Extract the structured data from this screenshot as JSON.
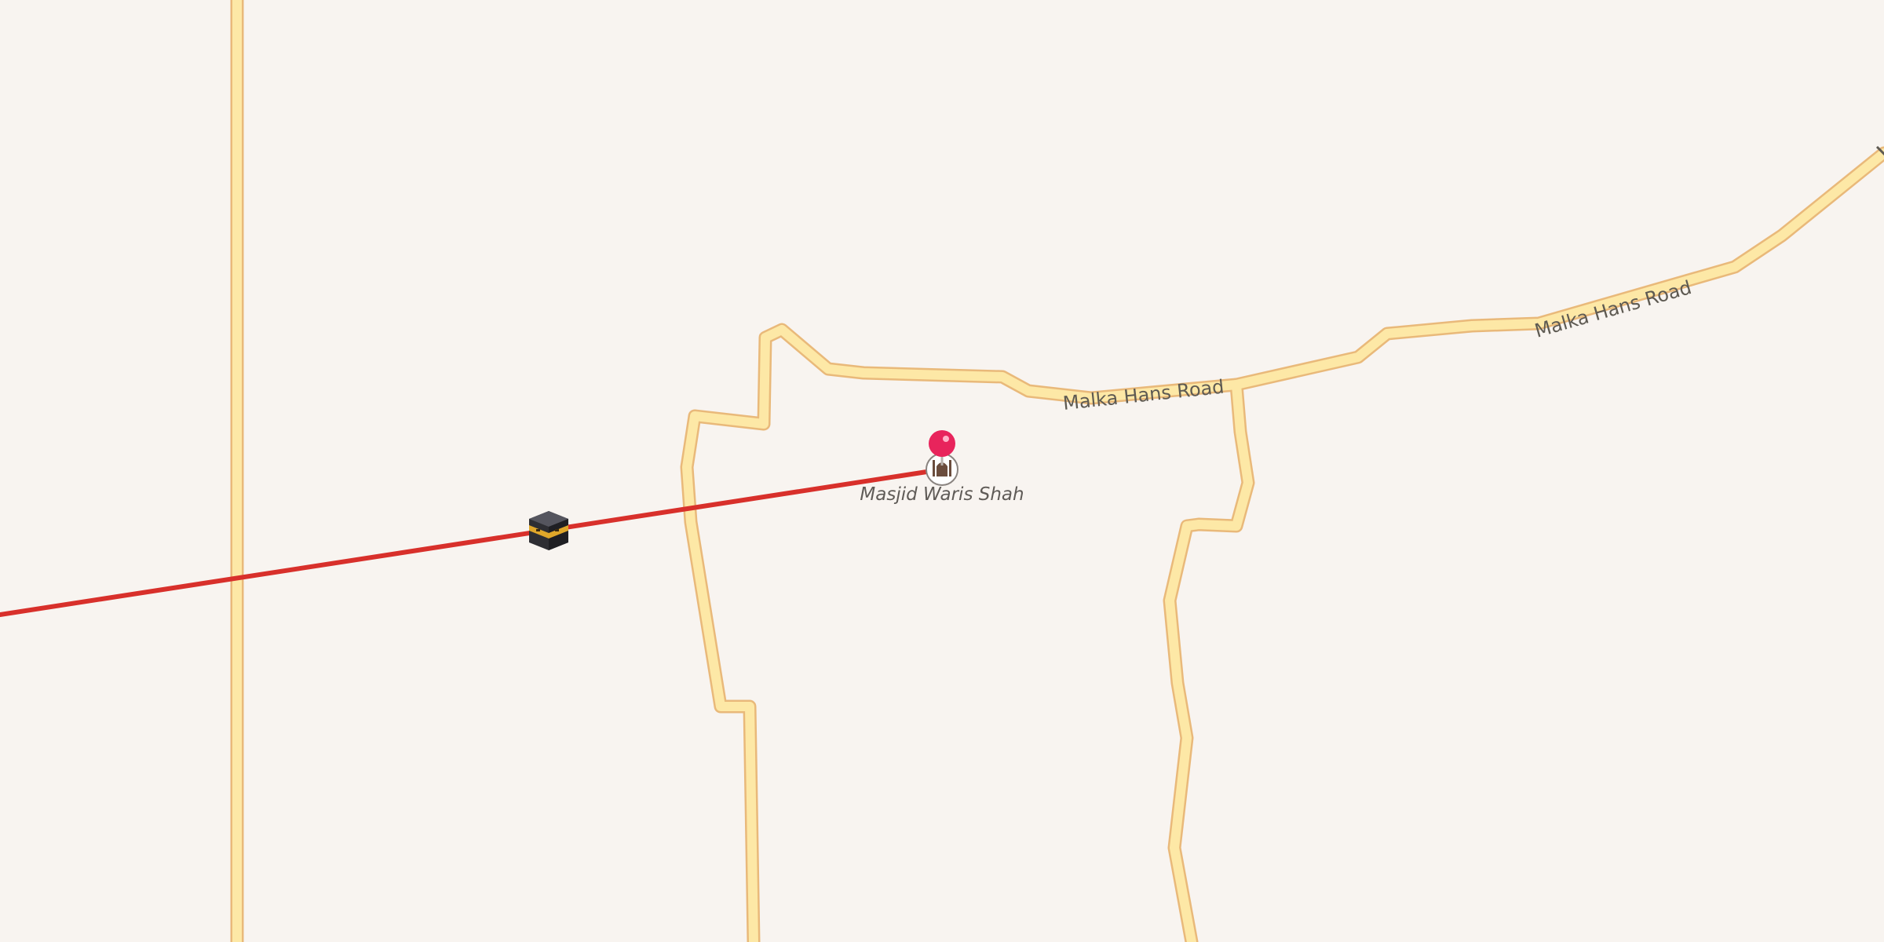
{
  "map": {
    "roads": [
      {
        "name": "Malka Hans Road",
        "labels": [
          "Malka Hans Road",
          "Malka Hans Road"
        ]
      }
    ],
    "poi": {
      "name": "Masjid Waris Shah",
      "icon": "mosque-icon"
    },
    "marker": {
      "icon": "map-pin-icon",
      "color": "#e8245c"
    },
    "qibla_line": {
      "color": "#d8302b",
      "icon": "kaaba-icon"
    },
    "colors": {
      "background": "#f8f4f0",
      "road_fill": "#fde8a6",
      "road_casing": "#e9b97a"
    }
  }
}
